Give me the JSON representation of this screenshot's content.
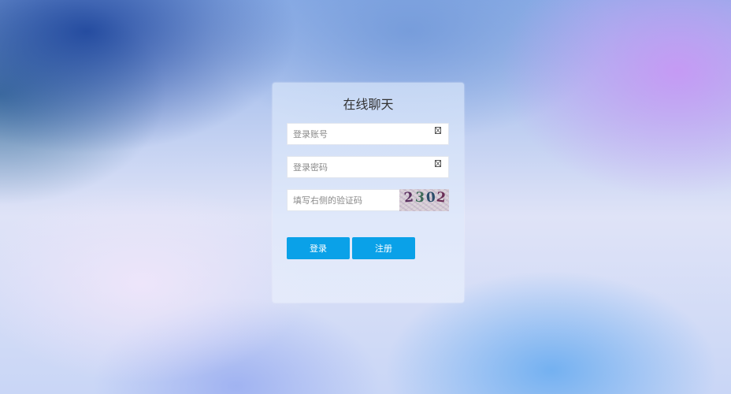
{
  "login_panel": {
    "title": "在线聊天",
    "username": {
      "placeholder": "登录账号",
      "value": ""
    },
    "password": {
      "placeholder": "登录密码",
      "value": ""
    },
    "captcha_input": {
      "placeholder": "填写右侧的验证码",
      "value": ""
    },
    "captcha_image": {
      "text": "2302",
      "digits": [
        "2",
        "3",
        "0",
        "2"
      ]
    },
    "login_button": "登录",
    "register_button": "注册"
  },
  "colors": {
    "accent": "#0aa1e8",
    "title_text": "#333333",
    "placeholder_text": "#8a8a8a"
  }
}
